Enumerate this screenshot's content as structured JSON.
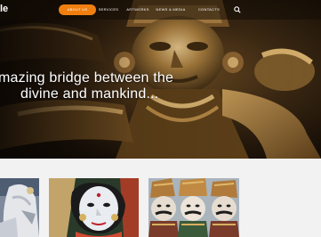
{
  "header": {
    "logo_text": "le",
    "nav": [
      {
        "label": "ABOUT US",
        "active": true
      },
      {
        "label": "SERVICES",
        "active": false
      },
      {
        "label": "ARTWORKS",
        "active": false
      },
      {
        "label": "NEWS & MEDIA",
        "active": false
      },
      {
        "label": "CONTACTS",
        "active": false
      }
    ],
    "search_icon": "search-icon",
    "accent_color": "#f07f10"
  },
  "hero": {
    "tagline_line1": "mazing bridge between the",
    "tagline_line2": "divine and mankind..."
  },
  "gallery": {
    "items": [
      {
        "name": "white-deity-statue"
      },
      {
        "name": "painted-goddess-statue"
      },
      {
        "name": "three-crowned-figures"
      }
    ]
  }
}
